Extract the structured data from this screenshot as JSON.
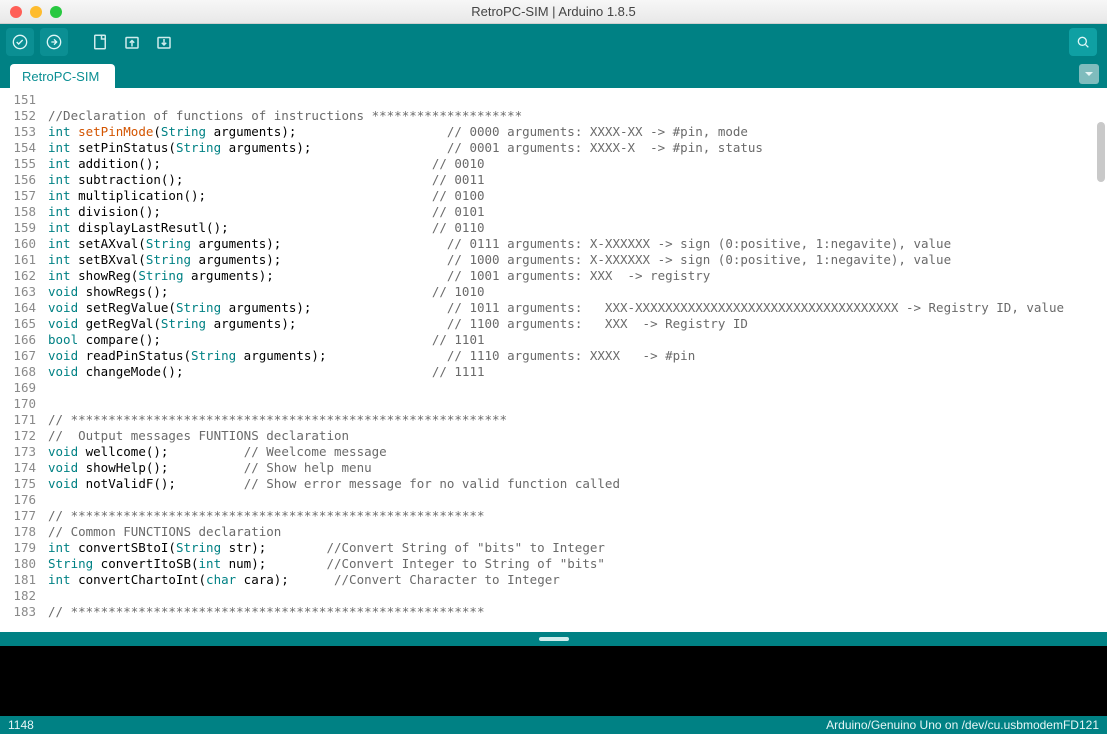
{
  "window": {
    "title": "RetroPC-SIM | Arduino 1.8.5"
  },
  "tab": {
    "label": "RetroPC-SIM"
  },
  "status": {
    "left": "1148",
    "right": "Arduino/Genuino Uno on /dev/cu.usbmodemFD121"
  },
  "editor": {
    "first_line": 151,
    "lines": [
      {
        "tokens": []
      },
      {
        "tokens": [
          {
            "t": "comment",
            "v": "//Declaration of functions of instructions ********************"
          }
        ]
      },
      {
        "tokens": [
          {
            "t": "kw-type",
            "v": "int"
          },
          {
            "t": "plain",
            "v": " "
          },
          {
            "t": "kw-func",
            "v": "setPinMode"
          },
          {
            "t": "plain",
            "v": "("
          },
          {
            "t": "kw-string",
            "v": "String"
          },
          {
            "t": "plain",
            "v": " arguments);                    "
          },
          {
            "t": "comment",
            "v": "// 0000 arguments: XXXX-XX -> #pin, mode"
          }
        ]
      },
      {
        "tokens": [
          {
            "t": "kw-type",
            "v": "int"
          },
          {
            "t": "plain",
            "v": " setPinStatus("
          },
          {
            "t": "kw-string",
            "v": "String"
          },
          {
            "t": "plain",
            "v": " arguments);                  "
          },
          {
            "t": "comment",
            "v": "// 0001 arguments: XXXX-X  -> #pin, status"
          }
        ]
      },
      {
        "tokens": [
          {
            "t": "kw-type",
            "v": "int"
          },
          {
            "t": "plain",
            "v": " addition();                                    "
          },
          {
            "t": "comment",
            "v": "// 0010"
          }
        ]
      },
      {
        "tokens": [
          {
            "t": "kw-type",
            "v": "int"
          },
          {
            "t": "plain",
            "v": " subtraction();                                 "
          },
          {
            "t": "comment",
            "v": "// 0011"
          }
        ]
      },
      {
        "tokens": [
          {
            "t": "kw-type",
            "v": "int"
          },
          {
            "t": "plain",
            "v": " multiplication();                              "
          },
          {
            "t": "comment",
            "v": "// 0100"
          }
        ]
      },
      {
        "tokens": [
          {
            "t": "kw-type",
            "v": "int"
          },
          {
            "t": "plain",
            "v": " division();                                    "
          },
          {
            "t": "comment",
            "v": "// 0101"
          }
        ]
      },
      {
        "tokens": [
          {
            "t": "kw-type",
            "v": "int"
          },
          {
            "t": "plain",
            "v": " displayLastResutl();                           "
          },
          {
            "t": "comment",
            "v": "// 0110"
          }
        ]
      },
      {
        "tokens": [
          {
            "t": "kw-type",
            "v": "int"
          },
          {
            "t": "plain",
            "v": " setAXval("
          },
          {
            "t": "kw-string",
            "v": "String"
          },
          {
            "t": "plain",
            "v": " arguments);                      "
          },
          {
            "t": "comment",
            "v": "// 0111 arguments: X-XXXXXX -> sign (0:positive, 1:negavite), value"
          }
        ]
      },
      {
        "tokens": [
          {
            "t": "kw-type",
            "v": "int"
          },
          {
            "t": "plain",
            "v": " setBXval("
          },
          {
            "t": "kw-string",
            "v": "String"
          },
          {
            "t": "plain",
            "v": " arguments);                      "
          },
          {
            "t": "comment",
            "v": "// 1000 arguments: X-XXXXXX -> sign (0:positive, 1:negavite), value"
          }
        ]
      },
      {
        "tokens": [
          {
            "t": "kw-type",
            "v": "int"
          },
          {
            "t": "plain",
            "v": " showReg("
          },
          {
            "t": "kw-string",
            "v": "String"
          },
          {
            "t": "plain",
            "v": " arguments);                       "
          },
          {
            "t": "comment",
            "v": "// 1001 arguments: XXX  -> registry"
          }
        ]
      },
      {
        "tokens": [
          {
            "t": "kw-type",
            "v": "void"
          },
          {
            "t": "plain",
            "v": " showRegs();                                   "
          },
          {
            "t": "comment",
            "v": "// 1010"
          }
        ]
      },
      {
        "tokens": [
          {
            "t": "kw-type",
            "v": "void"
          },
          {
            "t": "plain",
            "v": " setRegValue("
          },
          {
            "t": "kw-string",
            "v": "String"
          },
          {
            "t": "plain",
            "v": " arguments);                  "
          },
          {
            "t": "comment",
            "v": "// 1011 arguments:   XXX-XXXXXXXXXXXXXXXXXXXXXXXXXXXXXXXXXXX -> Registry ID, value"
          }
        ]
      },
      {
        "tokens": [
          {
            "t": "kw-type",
            "v": "void"
          },
          {
            "t": "plain",
            "v": " getRegVal("
          },
          {
            "t": "kw-string",
            "v": "String"
          },
          {
            "t": "plain",
            "v": " arguments);                    "
          },
          {
            "t": "comment",
            "v": "// 1100 arguments:   XXX  -> Registry ID"
          }
        ]
      },
      {
        "tokens": [
          {
            "t": "kw-type",
            "v": "bool"
          },
          {
            "t": "plain",
            "v": " compare();                                    "
          },
          {
            "t": "comment",
            "v": "// 1101"
          }
        ]
      },
      {
        "tokens": [
          {
            "t": "kw-type",
            "v": "void"
          },
          {
            "t": "plain",
            "v": " readPinStatus("
          },
          {
            "t": "kw-string",
            "v": "String"
          },
          {
            "t": "plain",
            "v": " arguments);                "
          },
          {
            "t": "comment",
            "v": "// 1110 arguments: XXXX   -> #pin"
          }
        ]
      },
      {
        "tokens": [
          {
            "t": "kw-type",
            "v": "void"
          },
          {
            "t": "plain",
            "v": " changeMode();                                 "
          },
          {
            "t": "comment",
            "v": "// 1111"
          }
        ]
      },
      {
        "tokens": []
      },
      {
        "tokens": []
      },
      {
        "tokens": [
          {
            "t": "comment",
            "v": "// **********************************************************"
          }
        ]
      },
      {
        "tokens": [
          {
            "t": "comment",
            "v": "//  Output messages FUNTIONS declaration"
          }
        ]
      },
      {
        "tokens": [
          {
            "t": "kw-type",
            "v": "void"
          },
          {
            "t": "plain",
            "v": " wellcome();          "
          },
          {
            "t": "comment",
            "v": "// Weelcome message"
          }
        ]
      },
      {
        "tokens": [
          {
            "t": "kw-type",
            "v": "void"
          },
          {
            "t": "plain",
            "v": " showHelp();          "
          },
          {
            "t": "comment",
            "v": "// Show help menu"
          }
        ]
      },
      {
        "tokens": [
          {
            "t": "kw-type",
            "v": "void"
          },
          {
            "t": "plain",
            "v": " notValidF();         "
          },
          {
            "t": "comment",
            "v": "// Show error message for no valid function called"
          }
        ]
      },
      {
        "tokens": []
      },
      {
        "tokens": [
          {
            "t": "comment",
            "v": "// *******************************************************"
          }
        ]
      },
      {
        "tokens": [
          {
            "t": "comment",
            "v": "// Common FUNCTIONS declaration"
          }
        ]
      },
      {
        "tokens": [
          {
            "t": "kw-type",
            "v": "int"
          },
          {
            "t": "plain",
            "v": " convertSBtoI("
          },
          {
            "t": "kw-string",
            "v": "String"
          },
          {
            "t": "plain",
            "v": " str);        "
          },
          {
            "t": "comment",
            "v": "//Convert String of \"bits\" to Integer"
          }
        ]
      },
      {
        "tokens": [
          {
            "t": "kw-string",
            "v": "String"
          },
          {
            "t": "plain",
            "v": " convertItoSB("
          },
          {
            "t": "kw-type",
            "v": "int"
          },
          {
            "t": "plain",
            "v": " num);        "
          },
          {
            "t": "comment",
            "v": "//Convert Integer to String of \"bits\""
          }
        ]
      },
      {
        "tokens": [
          {
            "t": "kw-type",
            "v": "int"
          },
          {
            "t": "plain",
            "v": " convertChartoInt("
          },
          {
            "t": "kw-type",
            "v": "char"
          },
          {
            "t": "plain",
            "v": " cara);      "
          },
          {
            "t": "comment",
            "v": "//Convert Character to Integer"
          }
        ]
      },
      {
        "tokens": []
      },
      {
        "tokens": [
          {
            "t": "comment",
            "v": "// *******************************************************"
          }
        ]
      }
    ]
  }
}
